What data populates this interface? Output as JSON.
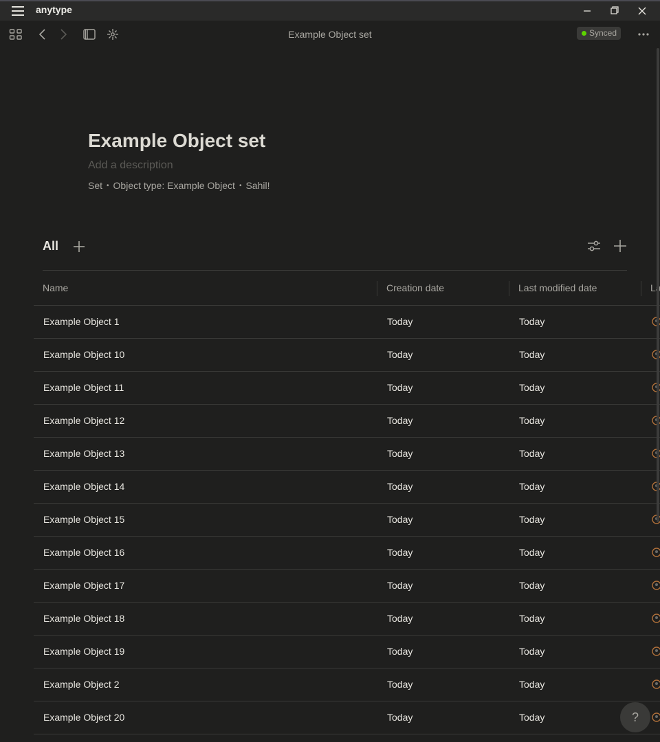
{
  "window": {
    "app_name": "anytype"
  },
  "toolbar": {
    "title": "Example Object set",
    "sync_status": "Synced",
    "sync_color": "#5dd400"
  },
  "page": {
    "title": "Example Object set",
    "description_placeholder": "Add a description",
    "meta": {
      "layout": "Set",
      "object_type": "Object type: Example Object",
      "creator": "Sahil!"
    }
  },
  "views": {
    "active": "All"
  },
  "table": {
    "columns": [
      "Name",
      "Creation date",
      "Last modified date",
      "La"
    ],
    "rows": [
      {
        "name": "Example Object 1",
        "created": "Today",
        "modified": "Today"
      },
      {
        "name": "Example Object 10",
        "created": "Today",
        "modified": "Today"
      },
      {
        "name": "Example Object 11",
        "created": "Today",
        "modified": "Today"
      },
      {
        "name": "Example Object 12",
        "created": "Today",
        "modified": "Today"
      },
      {
        "name": "Example Object 13",
        "created": "Today",
        "modified": "Today"
      },
      {
        "name": "Example Object 14",
        "created": "Today",
        "modified": "Today"
      },
      {
        "name": "Example Object 15",
        "created": "Today",
        "modified": "Today"
      },
      {
        "name": "Example Object 16",
        "created": "Today",
        "modified": "Today"
      },
      {
        "name": "Example Object 17",
        "created": "Today",
        "modified": "Today"
      },
      {
        "name": "Example Object 18",
        "created": "Today",
        "modified": "Today"
      },
      {
        "name": "Example Object 19",
        "created": "Today",
        "modified": "Today"
      },
      {
        "name": "Example Object 2",
        "created": "Today",
        "modified": "Today"
      },
      {
        "name": "Example Object 20",
        "created": "Today",
        "modified": "Today"
      }
    ]
  },
  "help": {
    "label": "?"
  }
}
